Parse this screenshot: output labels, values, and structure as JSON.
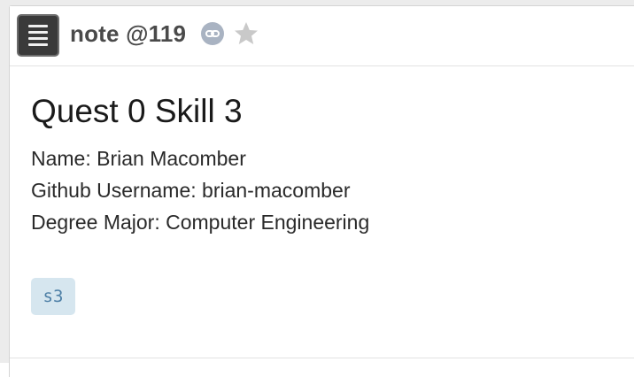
{
  "header": {
    "note_title": "note @119",
    "menu_icon": "hamburger-menu-icon",
    "link_icon": "link-icon",
    "star_icon": "star-icon",
    "star_color": "#c9c9c9",
    "link_color": "#a9b3c2"
  },
  "content": {
    "title": "Quest 0 Skill 3",
    "lines": [
      "Name: Brian Macomber",
      "Github Username: brian-macomber",
      "Degree Major: Computer Engineering"
    ]
  },
  "tags": [
    {
      "label": "s3",
      "background": "#d6e6ef",
      "color": "#4d7fa6"
    }
  ]
}
